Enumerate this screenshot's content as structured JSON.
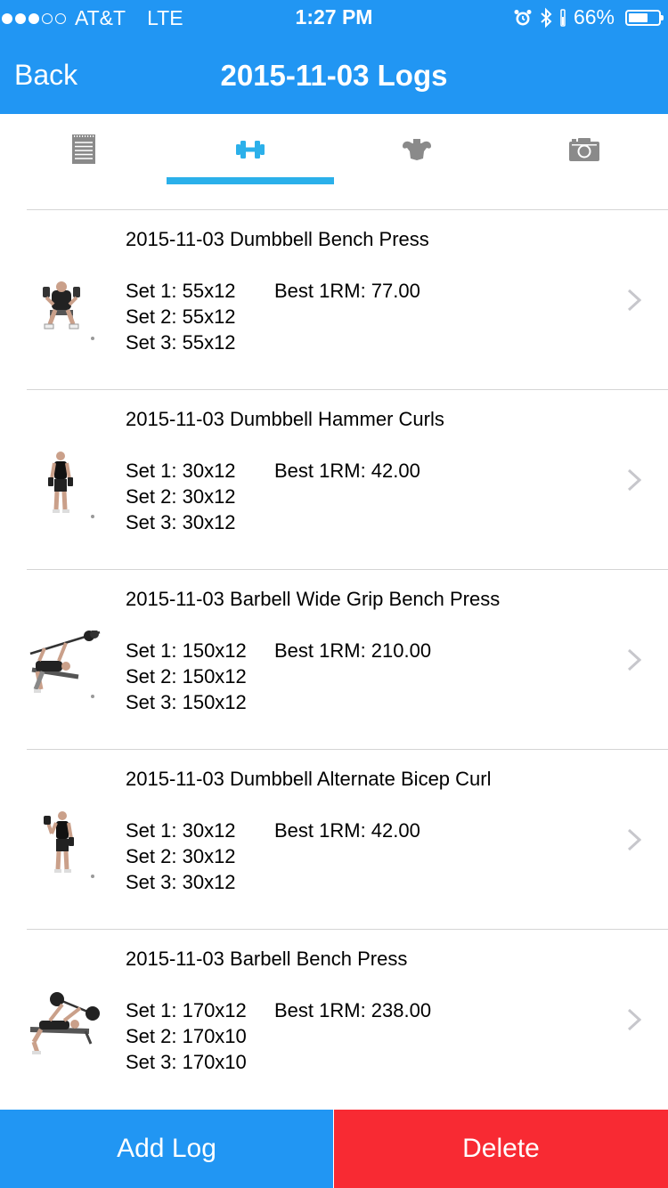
{
  "status": {
    "carrier": "AT&T",
    "network": "LTE",
    "time": "1:27 PM",
    "battery_text": "66%",
    "battery_level": 0.66,
    "signal_bars_filled": 3,
    "signal_bars_total": 5
  },
  "nav": {
    "back_label": "Back",
    "title": "2015-11-03 Logs"
  },
  "tabs": [
    {
      "icon": "notepad-icon",
      "active": false
    },
    {
      "icon": "dumbbell-icon",
      "active": true
    },
    {
      "icon": "muscle-torso-icon",
      "active": false
    },
    {
      "icon": "camera-icon",
      "active": false
    }
  ],
  "colors": {
    "header": "#2196f3",
    "tab_active": "#2bb0ea",
    "tab_inactive": "#8a8a8a",
    "delete": "#f82a33"
  },
  "logs": [
    {
      "title": "2015-11-03 Dumbbell Bench Press",
      "sets": [
        "Set 1: 55x12",
        "Set 2: 55x12",
        "Set 3: 55x12"
      ],
      "best": "Best 1RM: 77.00",
      "thumb": "bench-press-image"
    },
    {
      "title": "2015-11-03 Dumbbell Hammer Curls",
      "sets": [
        "Set 1: 30x12",
        "Set 2: 30x12",
        "Set 3: 30x12"
      ],
      "best": "Best 1RM: 42.00",
      "thumb": "hammer-curl-image"
    },
    {
      "title": "2015-11-03 Barbell Wide Grip Bench Press",
      "sets": [
        "Set 1: 150x12",
        "Set 2: 150x12",
        "Set 3: 150x12"
      ],
      "best": "Best 1RM: 210.00",
      "thumb": "wide-grip-bench-image"
    },
    {
      "title": "2015-11-03 Dumbbell Alternate Bicep Curl",
      "sets": [
        "Set 1: 30x12",
        "Set 2: 30x12",
        "Set 3: 30x12"
      ],
      "best": "Best 1RM: 42.00",
      "thumb": "bicep-curl-image"
    },
    {
      "title": "2015-11-03 Barbell Bench Press",
      "sets": [
        "Set 1: 170x12",
        "Set 2: 170x10",
        "Set 3: 170x10"
      ],
      "best": "Best 1RM: 238.00",
      "thumb": "barbell-bench-image"
    }
  ],
  "actions": {
    "add_label": "Add Log",
    "delete_label": "Delete"
  }
}
